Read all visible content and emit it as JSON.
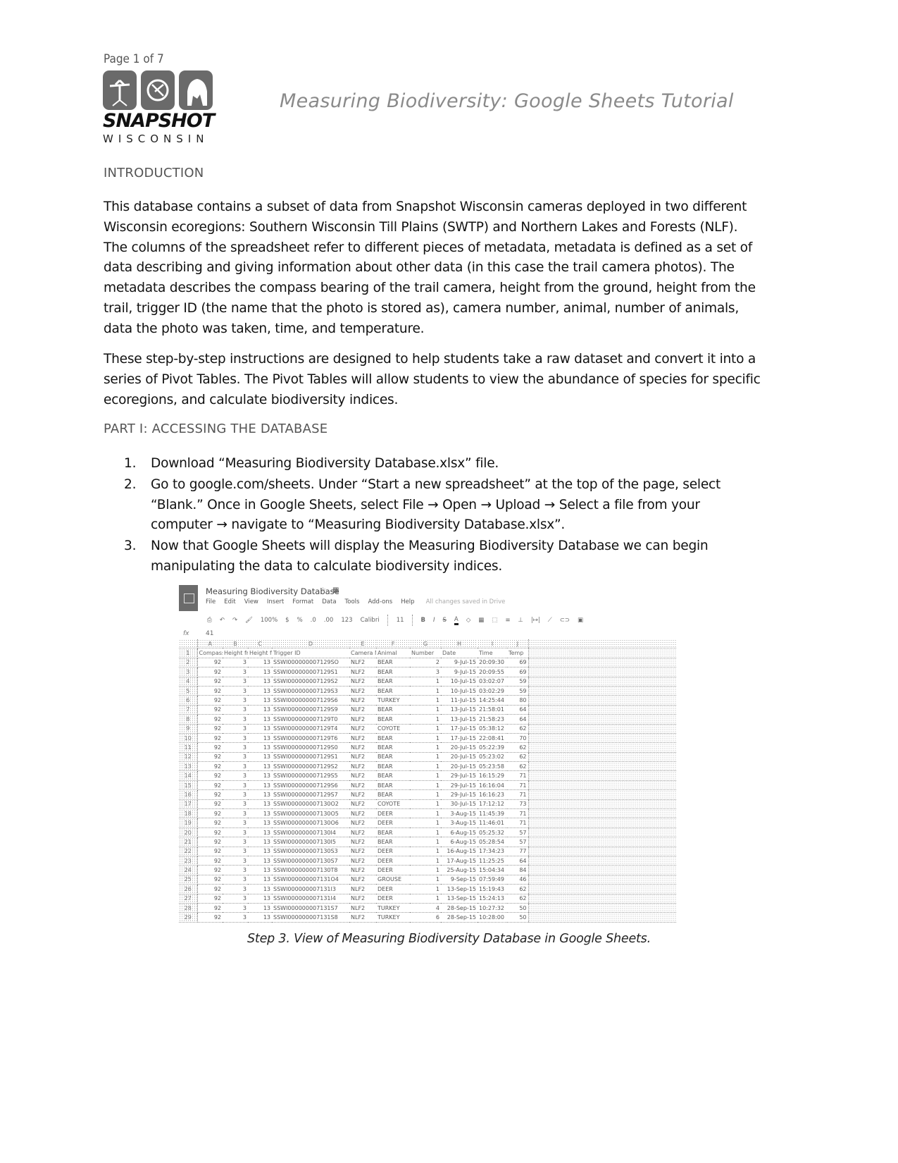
{
  "header": {
    "page_indicator": "Page 1 of 7",
    "logo_word": "SNAPSHOT",
    "logo_sub": "WISCONSIN",
    "title": "Measuring Biodiversity: Google Sheets Tutorial"
  },
  "intro": {
    "heading": "INTRODUCTION",
    "paragraphs": [
      "This database contains a subset of data from Snapshot Wisconsin cameras deployed in two different Wisconsin ecoregions: Southern Wisconsin Till Plains (SWTP) and Northern Lakes and Forests (NLF). The columns of the spreadsheet refer to different pieces of metadata, metadata is defined as a set of data describing and giving information about other data (in this case the trail camera photos). The metadata describes the compass bearing of the trail camera, height from the ground, height from the trail, trigger ID (the name that the photo is stored as), camera number, animal, number of animals, data the photo was taken, time, and temperature.",
      "These step-by-step instructions are designed to help students take a raw dataset and convert it into a series of Pivot Tables. The Pivot Tables will allow students to view the abundance of species for specific ecoregions, and calculate biodiversity indices."
    ]
  },
  "part1": {
    "heading": "PART I: ACCESSING THE DATABASE",
    "steps": [
      {
        "num": "1.",
        "text": "Download “Measuring Biodiversity Database.xlsx” file."
      },
      {
        "num": "2.",
        "text": "Go to google.com/sheets. Under “Start a new spreadsheet” at the top of the page, select “Blank.” Once in Google Sheets, select File → Open → Upload → Select a file from your computer → navigate to “Measuring Biodiversity Database.xlsx”."
      },
      {
        "num": "3.",
        "text": "Now that Google Sheets will display the Measuring Biodiversity Database we can begin manipulating the data to calculate biodiversity indices."
      }
    ]
  },
  "screenshot": {
    "doc_title": "Measuring Biodiversity Database",
    "star_icon": "star-icon",
    "folder_icon": "folder-icon",
    "menu": [
      "File",
      "Edit",
      "View",
      "Insert",
      "Format",
      "Data",
      "Tools",
      "Add-ons",
      "Help"
    ],
    "save_status": "All changes saved in Drive",
    "toolbar": {
      "zoom": "100%",
      "currency": "$",
      "percent": "%",
      "decimal_less": ".0",
      "decimal_more": ".00",
      "format_more": "123",
      "font": "Calibri",
      "font_size": "11",
      "bold": "B",
      "italic": "I",
      "strike": "S",
      "text_color": "A"
    },
    "formula_label": "fx",
    "formula_value": "41",
    "column_letters": [
      "A",
      "B",
      "C",
      "D",
      "E",
      "F",
      "G",
      "H",
      "I",
      "J"
    ],
    "headers": [
      "Compass B",
      "Height fr",
      "Height fr",
      "Trigger ID",
      "Camera N",
      "Animal",
      "Number",
      "Date",
      "Time",
      "Temp"
    ],
    "rows": [
      {
        "n": "2",
        "c": [
          "92",
          "3",
          "13",
          "SSWI000000007129SO",
          "NLF2",
          "BEAR",
          "2",
          "9-Jul-15",
          "20:09:30",
          "69"
        ]
      },
      {
        "n": "3",
        "c": [
          "92",
          "3",
          "13",
          "SSWI000000007129S1",
          "NLF2",
          "BEAR",
          "3",
          "9-Jul-15",
          "20:09:55",
          "69"
        ]
      },
      {
        "n": "4",
        "c": [
          "92",
          "3",
          "13",
          "SSWI000000007129S2",
          "NLF2",
          "BEAR",
          "1",
          "10-Jul-15",
          "03:02:07",
          "59"
        ]
      },
      {
        "n": "5",
        "c": [
          "92",
          "3",
          "13",
          "SSWI000000007129S3",
          "NLF2",
          "BEAR",
          "1",
          "10-Jul-15",
          "03:02:29",
          "59"
        ]
      },
      {
        "n": "6",
        "c": [
          "92",
          "3",
          "13",
          "SSWI000000007129S6",
          "NLF2",
          "TURKEY",
          "1",
          "11-Jul-15",
          "14:25:44",
          "80"
        ]
      },
      {
        "n": "7",
        "c": [
          "92",
          "3",
          "13",
          "SSWI000000007129S9",
          "NLF2",
          "BEAR",
          "1",
          "13-Jul-15",
          "21:58:01",
          "64"
        ]
      },
      {
        "n": "8",
        "c": [
          "92",
          "3",
          "13",
          "SSWI000000007129T0",
          "NLF2",
          "BEAR",
          "1",
          "13-Jul-15",
          "21:58:23",
          "64"
        ]
      },
      {
        "n": "9",
        "c": [
          "92",
          "3",
          "13",
          "SSWI000000007129T4",
          "NLF2",
          "COYOTE",
          "1",
          "17-Jul-15",
          "05:38:12",
          "62"
        ]
      },
      {
        "n": "10",
        "c": [
          "92",
          "3",
          "13",
          "SSWI000000007129T6",
          "NLF2",
          "BEAR",
          "1",
          "17-Jul-15",
          "22:08:41",
          "70"
        ]
      },
      {
        "n": "11",
        "c": [
          "92",
          "3",
          "13",
          "SSWI000000007129S0",
          "NLF2",
          "BEAR",
          "1",
          "20-Jul-15",
          "05:22:39",
          "62"
        ]
      },
      {
        "n": "12",
        "c": [
          "92",
          "3",
          "13",
          "SSWI000000007129S1",
          "NLF2",
          "BEAR",
          "1",
          "20-Jul-15",
          "05:23:02",
          "62"
        ]
      },
      {
        "n": "13",
        "c": [
          "92",
          "3",
          "13",
          "SSWI000000007129S2",
          "NLF2",
          "BEAR",
          "1",
          "20-Jul-15",
          "05:23:58",
          "62"
        ]
      },
      {
        "n": "14",
        "c": [
          "92",
          "3",
          "13",
          "SSWI000000007129S5",
          "NLF2",
          "BEAR",
          "1",
          "29-Jul-15",
          "16:15:29",
          "71"
        ]
      },
      {
        "n": "15",
        "c": [
          "92",
          "3",
          "13",
          "SSWI000000007129S6",
          "NLF2",
          "BEAR",
          "1",
          "29-Jul-15",
          "16:16:04",
          "71"
        ]
      },
      {
        "n": "16",
        "c": [
          "92",
          "3",
          "13",
          "SSWI000000007129S7",
          "NLF2",
          "BEAR",
          "1",
          "29-Jul-15",
          "16:16:23",
          "71"
        ]
      },
      {
        "n": "17",
        "c": [
          "92",
          "3",
          "13",
          "SSWI000000007130O2",
          "NLF2",
          "COYOTE",
          "1",
          "30-Jul-15",
          "17:12:12",
          "73"
        ]
      },
      {
        "n": "18",
        "c": [
          "92",
          "3",
          "13",
          "SSWI000000007130O5",
          "NLF2",
          "DEER",
          "1",
          "3-Aug-15",
          "11:45:39",
          "71"
        ]
      },
      {
        "n": "19",
        "c": [
          "92",
          "3",
          "13",
          "SSWI000000007130O6",
          "NLF2",
          "DEER",
          "1",
          "3-Aug-15",
          "11:46:01",
          "71"
        ]
      },
      {
        "n": "20",
        "c": [
          "92",
          "3",
          "13",
          "SSWI000000007130I4",
          "NLF2",
          "BEAR",
          "1",
          "6-Aug-15",
          "05:25:32",
          "57"
        ]
      },
      {
        "n": "21",
        "c": [
          "92",
          "3",
          "13",
          "SSWI000000007130I5",
          "NLF2",
          "BEAR",
          "1",
          "6-Aug-15",
          "05:28:54",
          "57"
        ]
      },
      {
        "n": "22",
        "c": [
          "92",
          "3",
          "13",
          "SSWI000000007130S3",
          "NLF2",
          "DEER",
          "1",
          "16-Aug-15",
          "17:34:23",
          "77"
        ]
      },
      {
        "n": "23",
        "c": [
          "92",
          "3",
          "13",
          "SSWI000000007130S7",
          "NLF2",
          "DEER",
          "1",
          "17-Aug-15",
          "11:25:25",
          "64"
        ]
      },
      {
        "n": "24",
        "c": [
          "92",
          "3",
          "13",
          "SSWI000000007130T8",
          "NLF2",
          "DEER",
          "1",
          "25-Aug-15",
          "15:04:34",
          "84"
        ]
      },
      {
        "n": "25",
        "c": [
          "92",
          "3",
          "13",
          "SSWI000000007131O4",
          "NLF2",
          "GROUSE",
          "1",
          "9-Sep-15",
          "07:59:49",
          "46"
        ]
      },
      {
        "n": "26",
        "c": [
          "92",
          "3",
          "13",
          "SSWI000000007131I3",
          "NLF2",
          "DEER",
          "1",
          "13-Sep-15",
          "15:19:43",
          "62"
        ]
      },
      {
        "n": "27",
        "c": [
          "92",
          "3",
          "13",
          "SSWI000000007131I4",
          "NLF2",
          "DEER",
          "1",
          "13-Sep-15",
          "15:24:13",
          "62"
        ]
      },
      {
        "n": "28",
        "c": [
          "92",
          "3",
          "13",
          "SSWI000000007131S7",
          "NLF2",
          "TURKEY",
          "4",
          "28-Sep-15",
          "10:27:32",
          "50"
        ]
      },
      {
        "n": "29",
        "c": [
          "92",
          "3",
          "13",
          "SSWI000000007131S8",
          "NLF2",
          "TURKEY",
          "6",
          "28-Sep-15",
          "10:28:00",
          "50"
        ]
      }
    ]
  },
  "caption": "Step 3. View of Measuring Biodiversity Database in Google Sheets."
}
